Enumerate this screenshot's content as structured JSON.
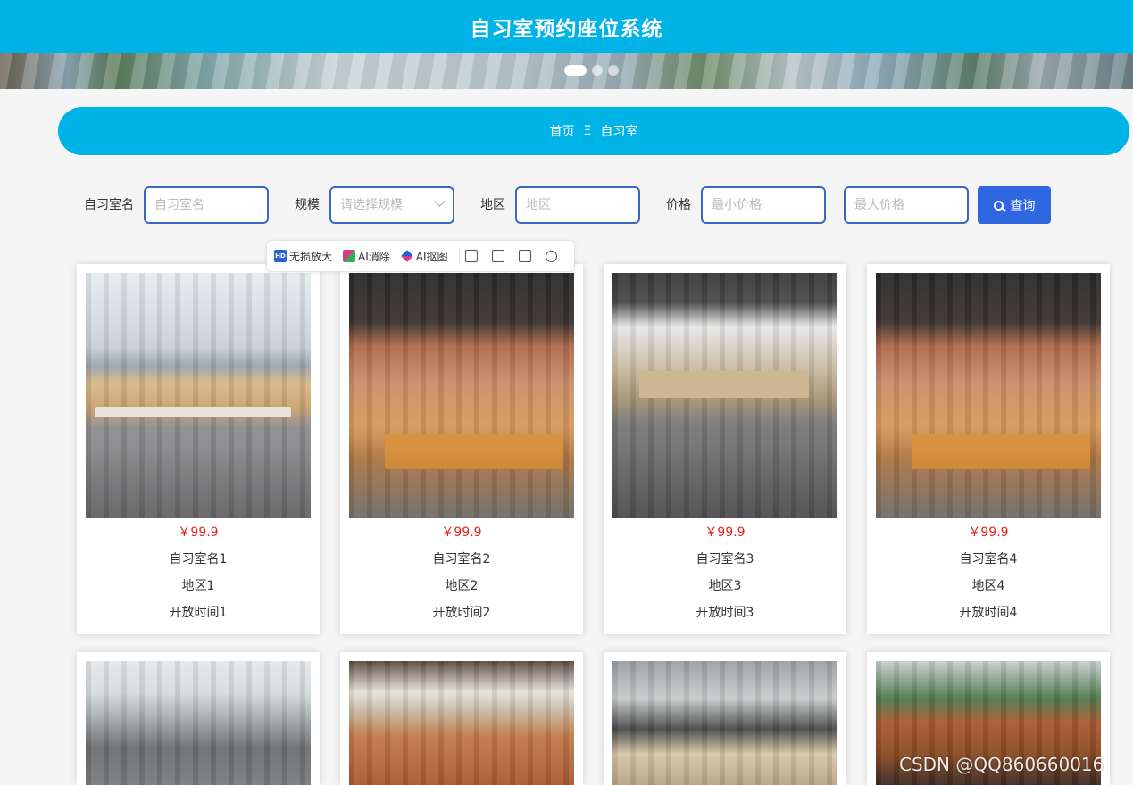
{
  "header": {
    "title": "自习室预约座位系统"
  },
  "banner": {
    "dot_count": 3,
    "active_index": 0
  },
  "breadcrumb": {
    "home": "首页",
    "separator": "Ξ",
    "current": "自习室"
  },
  "search": {
    "name_label": "自习室名",
    "name_placeholder": "自习室名",
    "scale_label": "规模",
    "scale_placeholder": "请选择规模",
    "region_label": "地区",
    "region_placeholder": "地区",
    "price_label": "价格",
    "min_price_placeholder": "最小价格",
    "max_price_placeholder": "最大价格",
    "query_button": "查询"
  },
  "image_toolbar": {
    "lossless_zoom": "无损放大",
    "ai_erase": "AI消除",
    "ai_cutout": "AI抠图"
  },
  "rooms": [
    {
      "price": "￥99.9",
      "name": "自习室名1",
      "region": "地区1",
      "open_time": "开放时间1"
    },
    {
      "price": "￥99.9",
      "name": "自习室名2",
      "region": "地区2",
      "open_time": "开放时间2"
    },
    {
      "price": "￥99.9",
      "name": "自习室名3",
      "region": "地区3",
      "open_time": "开放时间3"
    },
    {
      "price": "￥99.9",
      "name": "自习室名4",
      "region": "地区4",
      "open_time": "开放时间4"
    }
  ],
  "watermark": "CSDN @QQ860660016",
  "colors": {
    "primary": "#00b3e6",
    "button": "#2f67e0",
    "price": "#e2231a",
    "input_border": "#3a67c4"
  }
}
